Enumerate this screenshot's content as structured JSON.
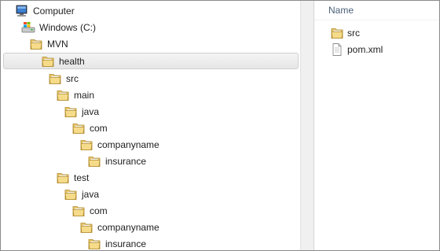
{
  "tree": [
    {
      "label": "Computer",
      "icon": "computer-icon"
    },
    {
      "label": "Windows (C:)",
      "icon": "drive-icon"
    },
    {
      "label": "MVN",
      "icon": "folder-icon"
    },
    {
      "label": "health",
      "icon": "folder-icon",
      "selected": true
    },
    {
      "label": "src",
      "icon": "folder-icon"
    },
    {
      "label": "main",
      "icon": "folder-icon"
    },
    {
      "label": "java",
      "icon": "folder-icon"
    },
    {
      "label": "com",
      "icon": "folder-icon"
    },
    {
      "label": "companyname",
      "icon": "folder-icon"
    },
    {
      "label": "insurance",
      "icon": "folder-icon"
    },
    {
      "label": "test",
      "icon": "folder-icon"
    },
    {
      "label": "java",
      "icon": "folder-icon"
    },
    {
      "label": "com",
      "icon": "folder-icon"
    },
    {
      "label": "companyname",
      "icon": "folder-icon"
    },
    {
      "label": "insurance",
      "icon": "folder-icon"
    }
  ],
  "content": {
    "column_header": "Name",
    "items": [
      {
        "label": "src",
        "icon": "folder-icon"
      },
      {
        "label": "pom.xml",
        "icon": "file-icon"
      }
    ]
  }
}
